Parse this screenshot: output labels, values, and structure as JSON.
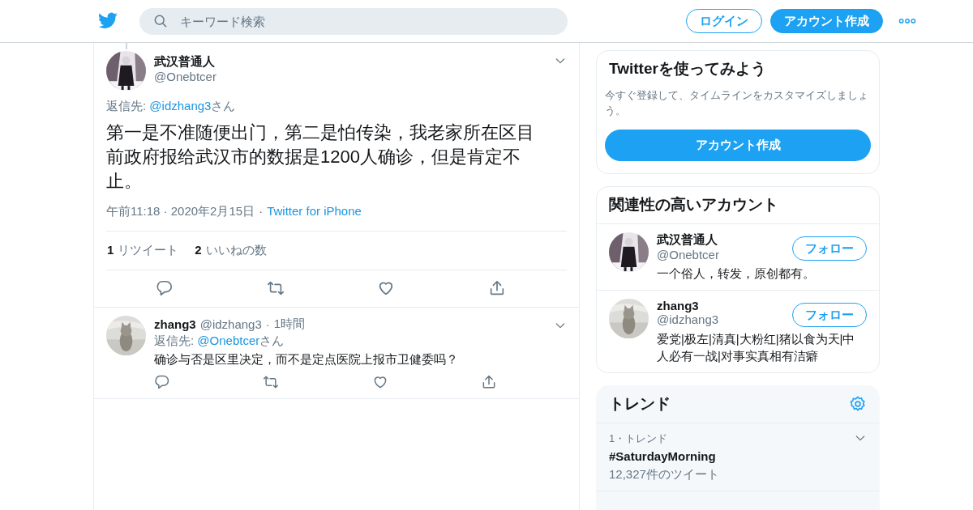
{
  "header": {
    "search": {
      "placeholder": "キーワード検索"
    },
    "buttons": [
      {
        "label": "ログイン",
        "kind": "outline"
      },
      {
        "label": "アカウント作成",
        "kind": "filled"
      }
    ]
  },
  "tweet": {
    "name": "武汉普通人",
    "handle": "@Onebtcer",
    "reply_to": {
      "prefix": "返信先: ",
      "mention": "@idzhang3",
      "suffix": "さん"
    },
    "text": "第一是不准随便出门，第二是怕传染，我老家所在区目前政府报给武汉市的数据是1200人确诊，但是肯定不止。",
    "time": "午前11:18 · 2020年2月15日",
    "separator": "·",
    "source": "Twitter for iPhone",
    "stats": [
      {
        "count": "1",
        "label": "リツイート"
      },
      {
        "count": "2",
        "label": "いいねの数"
      }
    ]
  },
  "replies": [
    {
      "name": "zhang3",
      "handle": "@idzhang3",
      "separator": "·",
      "time": "1時間",
      "reply_to": {
        "prefix": "返信先: ",
        "mention": "@Onebtcer",
        "suffix": "さん"
      },
      "text": "确诊与否是区里决定，而不是定点医院上报市卫健委吗？"
    }
  ],
  "sidebar": {
    "signup": {
      "title": "Twitterを使ってみよう",
      "description": "今すぐ登録して、タイムラインをカスタマイズしましょう。",
      "button": "アカウント作成"
    },
    "accounts": {
      "title": "関連性の高いアカウント",
      "items": [
        {
          "name": "武汉普通人",
          "handle": "@Onebtcer",
          "follow": "フォロー",
          "bio": "一个俗人，转发，原创都有。"
        },
        {
          "name": "zhang3",
          "handle": "@idzhang3",
          "follow": "フォロー",
          "bio": "爱党|极左|清真|大粉红|猪以食为天|中人必有一战|对事实真相有洁癖"
        }
      ]
    },
    "trends": {
      "title": "トレンド",
      "items": [
        {
          "rank": "1・トレンド",
          "name": "#SaturdayMorning",
          "count": "12,327件のツイート"
        }
      ]
    }
  }
}
